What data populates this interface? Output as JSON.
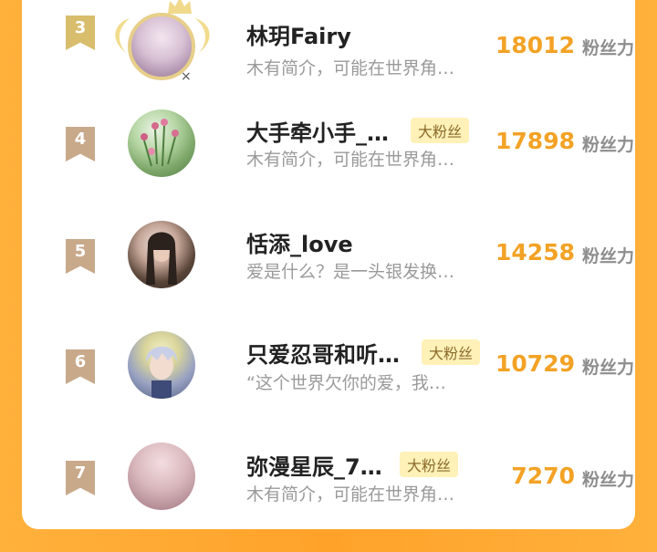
{
  "unit_label": "粉丝力",
  "badge_label": "大粉丝",
  "entries": [
    {
      "rank": "3",
      "name": "林玥Fairy",
      "bio": "木有简介，可能在世界角…",
      "score": "18012",
      "badge": false,
      "avatar_icon": "avatar-anime-girl"
    },
    {
      "rank": "4",
      "name": "大手牵小手_…",
      "bio": "木有简介，可能在世界角…",
      "score": "17898",
      "badge": true,
      "avatar_icon": "avatar-flowers"
    },
    {
      "rank": "5",
      "name": "恬添_love",
      "bio": "爱是什么？是一头银发换…",
      "score": "14258",
      "badge": false,
      "avatar_icon": "avatar-girl-photo"
    },
    {
      "rank": "6",
      "name": "只爱忍哥和听…",
      "bio": "“这个世界欠你的爱，我…",
      "score": "10729",
      "badge": true,
      "avatar_icon": "avatar-anime-boy"
    },
    {
      "rank": "7",
      "name": "弥漫星辰_7…",
      "bio": "木有简介，可能在世界角…",
      "score": "7270",
      "badge": true,
      "avatar_icon": "avatar-pink"
    }
  ],
  "colors": {
    "accent": "#f3a225",
    "background": "#ffa22a",
    "badge_bg": "#fff1b8",
    "rank_gold": "#d8bd6c",
    "rank_default": "#c8a98a"
  }
}
